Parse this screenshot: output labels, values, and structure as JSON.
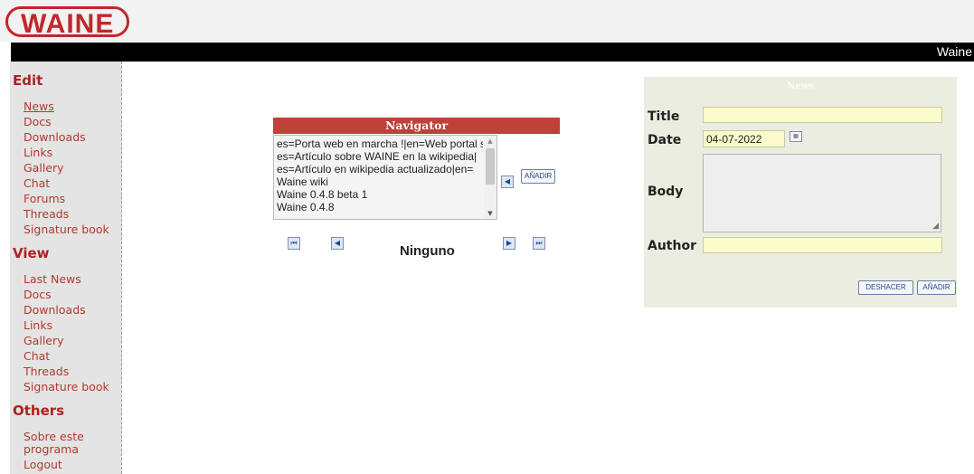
{
  "header": {
    "logo": "WAINE",
    "bar_text": "Waine"
  },
  "sidebar": {
    "sections": [
      {
        "title": "Edit",
        "items": [
          "News",
          "Docs",
          "Downloads",
          "Links",
          "Gallery",
          "Chat",
          "Forums",
          "Threads",
          "Signature book"
        ]
      },
      {
        "title": "View",
        "items": [
          "Last News",
          "Docs",
          "Downloads",
          "Links",
          "Gallery",
          "Chat",
          "Threads",
          "Signature book"
        ]
      },
      {
        "title": "Others",
        "items": [
          "Sobre este",
          "programa",
          "Logout"
        ]
      }
    ]
  },
  "navigator": {
    "title": "Navigator",
    "items": [
      "es=Porta web en marcha !|en=Web portal s",
      "es=Artículo sobre WAINE en la wikipedia|",
      "es=Artículo en wikipedia actualizado|en=",
      "Waine wiki",
      "Waine 0.4.8 beta 1",
      "Waine 0.4.8"
    ],
    "add_button": "AÑADIR",
    "status": "Ninguno"
  },
  "news_form": {
    "title": "News",
    "title_label": "Title",
    "title_value": "",
    "date_label": "Date",
    "date_value": "04-07-2022",
    "body_label": "Body",
    "body_value": "",
    "author_label": "Author",
    "author_value": "",
    "undo_button": "DESHACER",
    "add_button": "AÑADIR"
  },
  "colors": {
    "brand": "#c0282a",
    "nav_header": "#c0403a",
    "panel_bg": "#eaeddf",
    "input_bg": "#fbfbcb",
    "link": "#b03a2e"
  }
}
